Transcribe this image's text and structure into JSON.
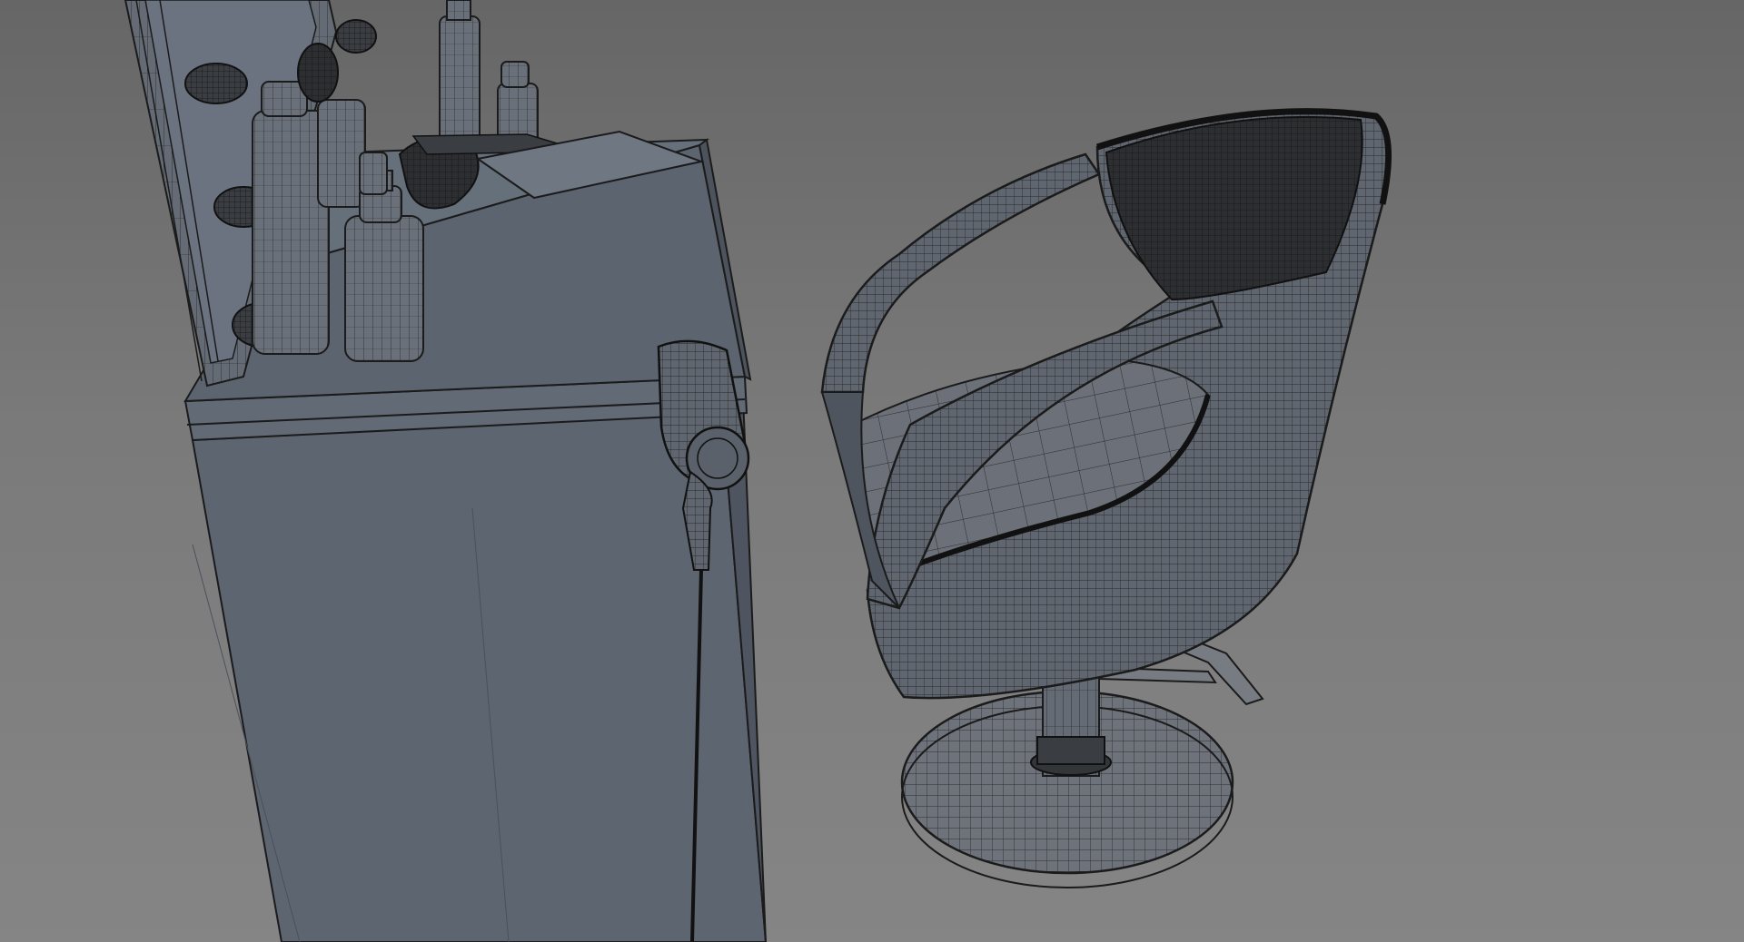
{
  "scene": {
    "background_top": "#666666",
    "background_bottom": "#858585",
    "mesh_color": "#5b6470",
    "wire_color": "#1e1e1e",
    "objects": [
      "vanity-cabinet",
      "mirror-frame",
      "vanity-bulb",
      "hair-product-bottle",
      "hair-brush",
      "paper-sheet",
      "hair-dryer",
      "salon-chair"
    ]
  }
}
